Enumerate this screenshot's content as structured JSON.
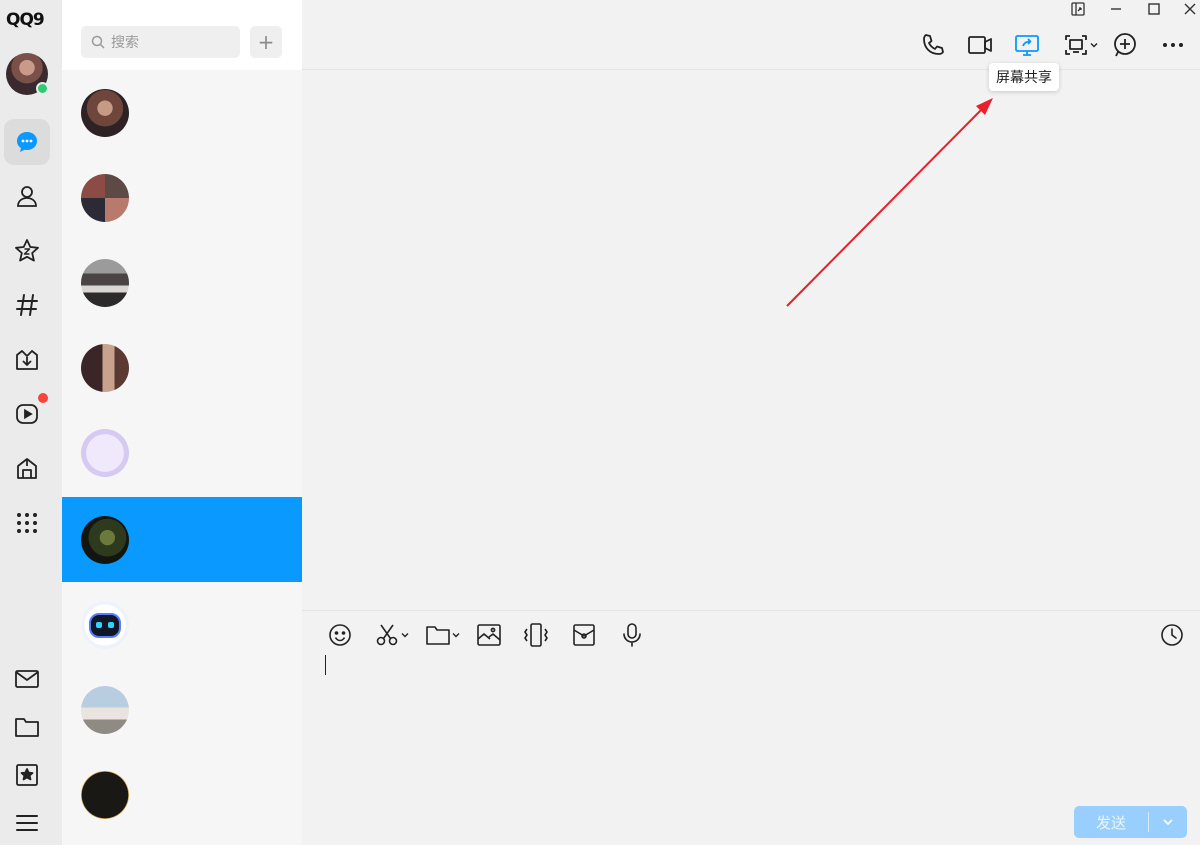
{
  "app": {
    "logo": "QQ9"
  },
  "colors": {
    "accent": "#0a99ff",
    "online": "#2ecc71",
    "badge": "#f5443d",
    "arrow": "#e8202a"
  },
  "nav": {
    "items": [
      {
        "name": "messages",
        "icon": "chat-bubble-icon",
        "active": true
      },
      {
        "name": "contacts",
        "icon": "person-icon"
      },
      {
        "name": "qzone",
        "icon": "star-z-icon"
      },
      {
        "name": "channels",
        "icon": "hash-icon"
      },
      {
        "name": "games",
        "icon": "game-icon"
      },
      {
        "name": "video",
        "icon": "video-play-icon",
        "badge": true
      },
      {
        "name": "mini-apps",
        "icon": "cube-icon"
      },
      {
        "name": "more-apps",
        "icon": "grid-dots-icon"
      }
    ],
    "bottom": [
      {
        "name": "mail",
        "icon": "mail-icon"
      },
      {
        "name": "files",
        "icon": "folder-icon"
      },
      {
        "name": "favorites",
        "icon": "bookmark-star-icon"
      },
      {
        "name": "main-menu",
        "icon": "hamburger-icon"
      }
    ]
  },
  "search": {
    "placeholder": "搜索"
  },
  "add_button": "+",
  "contacts": [
    {
      "avatar": "sunset-portrait"
    },
    {
      "avatar": "group-collage"
    },
    {
      "avatar": "auditorium-photo"
    },
    {
      "avatar": "two-girls-photo"
    },
    {
      "avatar": "lilac-handwriting"
    },
    {
      "avatar": "dark-green-scene",
      "selected": true
    },
    {
      "avatar": "robot-bot"
    },
    {
      "avatar": "campus-building"
    },
    {
      "avatar": "749-badge"
    }
  ],
  "header_actions": [
    {
      "name": "voice-call",
      "icon": "phone-icon"
    },
    {
      "name": "video-call",
      "icon": "video-camera-icon"
    },
    {
      "name": "screen-share",
      "icon": "screen-share-icon",
      "highlighted": true
    },
    {
      "name": "remote-assist",
      "icon": "remote-desktop-icon"
    },
    {
      "name": "add-members",
      "icon": "plus-circle-icon"
    },
    {
      "name": "more",
      "icon": "ellipsis-icon"
    }
  ],
  "tooltip": {
    "text": "屏幕共享"
  },
  "toolbar": [
    {
      "name": "emoji",
      "icon": "smiley-icon"
    },
    {
      "name": "screenshot",
      "icon": "scissors-icon"
    },
    {
      "name": "file",
      "icon": "folder-icon"
    },
    {
      "name": "image",
      "icon": "image-icon"
    },
    {
      "name": "shake",
      "icon": "shake-icon"
    },
    {
      "name": "red-packet",
      "icon": "red-packet-icon"
    },
    {
      "name": "voice",
      "icon": "microphone-icon"
    },
    {
      "name": "history",
      "icon": "clock-icon"
    }
  ],
  "send": {
    "label": "发送"
  }
}
